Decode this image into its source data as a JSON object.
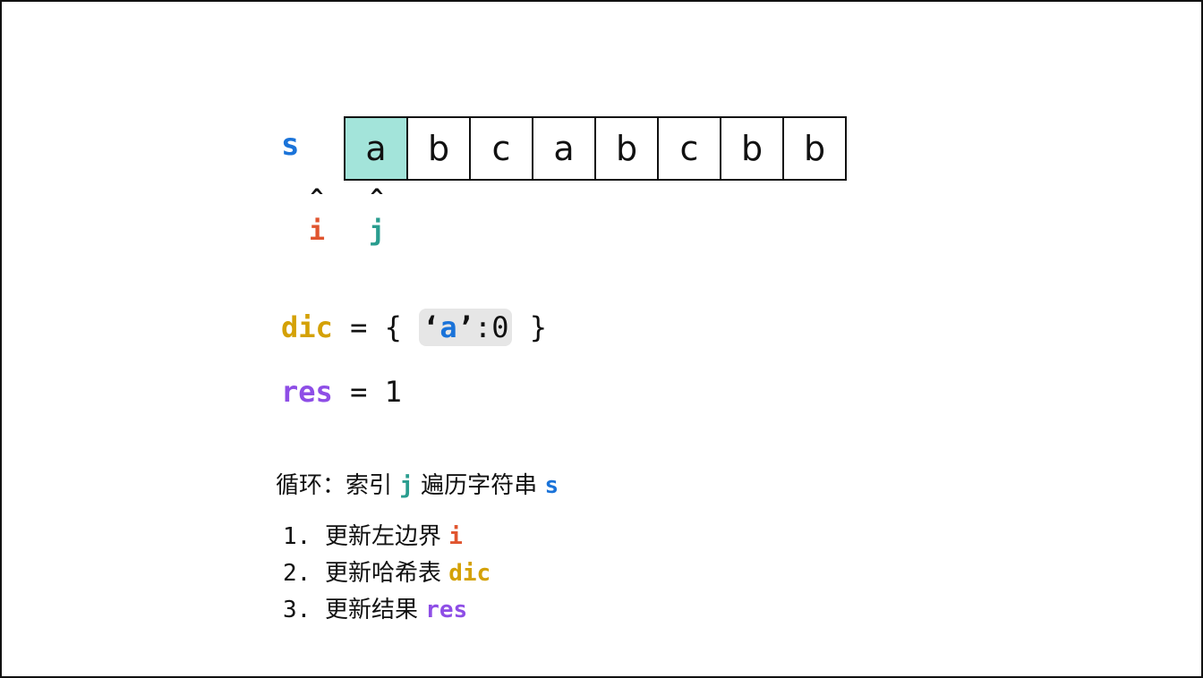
{
  "string_label": "s",
  "cells": [
    {
      "char": "a",
      "active": true
    },
    {
      "char": "b",
      "active": false
    },
    {
      "char": "c",
      "active": false
    },
    {
      "char": "a",
      "active": false
    },
    {
      "char": "b",
      "active": false
    },
    {
      "char": "c",
      "active": false
    },
    {
      "char": "b",
      "active": false
    },
    {
      "char": "b",
      "active": false
    }
  ],
  "pointers": {
    "caret": "^",
    "i": "i",
    "j": "j"
  },
  "dic_line": {
    "name": "dic",
    "eq": " = { ",
    "quote_open": "‘",
    "key": "a",
    "quote_close": "’",
    "value": ":0",
    "close": " }"
  },
  "res_line": {
    "name": "res",
    "eq": " = 1"
  },
  "loop": {
    "prefix": "循环：索引 ",
    "var_j": "j",
    "middle": " 遍历字符串 ",
    "var_s": "s"
  },
  "steps": [
    {
      "num": "1. ",
      "text": "更新左边界 ",
      "var": "i"
    },
    {
      "num": "2. ",
      "text": "更新哈希表 ",
      "var": "dic"
    },
    {
      "num": "3. ",
      "text": "更新结果 ",
      "var": "res"
    }
  ],
  "colors": {
    "s": "#1a73d9",
    "i": "#e0552f",
    "j": "#2a9d8f",
    "dic": "#d4a106",
    "res": "#8e4ee6",
    "active_cell": "#a3e4da",
    "entry_bg": "#e6e6e6"
  }
}
